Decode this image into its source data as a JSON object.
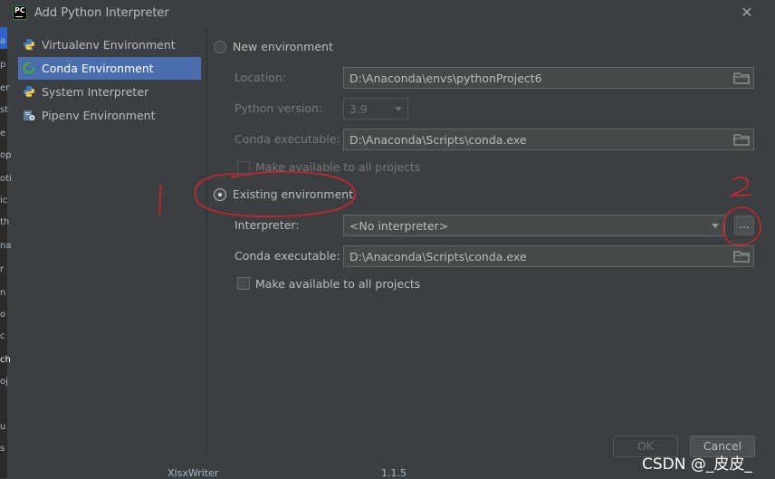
{
  "window": {
    "title": "Add Python Interpreter",
    "app_icon_text": "PC"
  },
  "sidebar": {
    "items": [
      {
        "label": "Virtualenv Environment",
        "icon": "python-venv-icon",
        "active": false
      },
      {
        "label": "Conda Environment",
        "icon": "conda-icon",
        "active": true
      },
      {
        "label": "System Interpreter",
        "icon": "python-icon",
        "active": false
      },
      {
        "label": "Pipenv Environment",
        "icon": "pipenv-icon",
        "active": false
      }
    ]
  },
  "new_env": {
    "radio_label": "New environment",
    "location_label": "Location:",
    "location_value": "D:\\Anaconda\\envs\\pythonProject6",
    "python_version_label": "Python version:",
    "python_version_value": "3.9",
    "conda_exe_label": "Conda executable:",
    "conda_exe_value": "D:\\Anaconda\\Scripts\\conda.exe",
    "make_available_label": "Make available to all projects"
  },
  "existing_env": {
    "radio_label": "Existing environment",
    "interpreter_label": "Interpreter:",
    "interpreter_value": "<No interpreter>",
    "browse_label": "...",
    "conda_exe_label": "Conda executable:",
    "conda_exe_value": "D:\\Anaconda\\Scripts\\conda.exe",
    "make_available_label": "Make available to all projects"
  },
  "selected_option": "existing",
  "buttons": {
    "ok": "OK",
    "cancel": "Cancel"
  },
  "annotations": {
    "mark1": "1",
    "mark2": "2"
  },
  "background": {
    "left_strip": [
      "a",
      "p",
      "er",
      "st",
      "e",
      "op",
      "oti",
      "ic",
      "th",
      "na",
      "r",
      "n",
      "o",
      "c",
      "ch",
      "oj",
      "",
      "u",
      "s"
    ],
    "bottom_row": {
      "package": "XlsxWriter",
      "version": "1.1.5"
    }
  },
  "watermark": "CSDN @_皮皮_",
  "colors": {
    "background": "#3c3f41",
    "accent": "#4b6eaf",
    "annotation": "#d2232a"
  }
}
